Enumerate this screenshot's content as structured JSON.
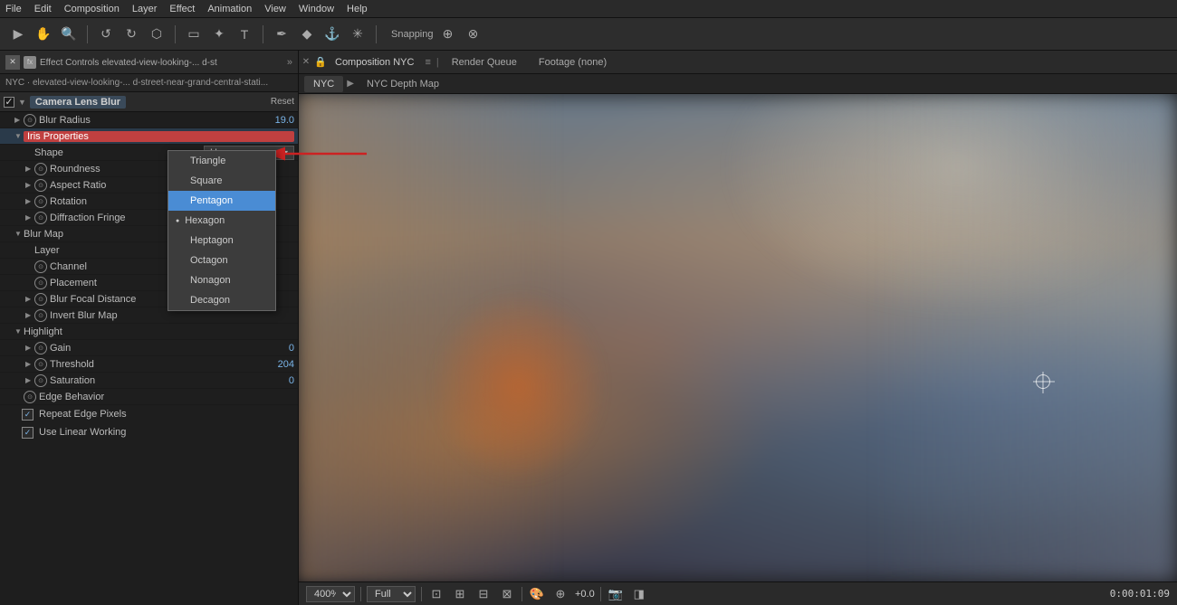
{
  "menubar": {
    "items": [
      "File",
      "Edit",
      "Composition",
      "Layer",
      "Effect",
      "Animation",
      "View",
      "Window",
      "Help"
    ]
  },
  "toolbar": {
    "snapping_label": "Snapping"
  },
  "left_panel": {
    "title": "Effect Controls",
    "title_suffix": "elevated-view-looking-... d-st",
    "breadcrumb": "NYC · elevated-view-looking-... d-street-near-grand-central-stati...",
    "effect": {
      "name": "Camera Lens Blur",
      "reset_label": "Reset",
      "blur_radius_label": "Blur Radius",
      "blur_radius_value": "19.0",
      "iris_properties_label": "Iris Properties",
      "iris_shape_label": "Shape",
      "iris_shape_value": "Hexagon",
      "iris_roundness_label": "Roundness",
      "iris_aspect_ratio_label": "Aspect Ratio",
      "iris_rotation_label": "Rotation",
      "iris_diffraction_label": "Diffraction Fringe",
      "blur_map_label": "Blur Map",
      "blur_map_layer_label": "Layer",
      "blur_map_channel_label": "Channel",
      "blur_map_placement_label": "Placement",
      "blur_focal_distance_label": "Blur Focal Distance",
      "invert_blur_map_label": "Invert Blur Map",
      "highlight_label": "Highlight",
      "gain_label": "Gain",
      "gain_value": "0",
      "threshold_label": "Threshold",
      "threshold_value": "204",
      "saturation_label": "Saturation",
      "saturation_value": "0",
      "edge_behavior_label": "Edge Behavior",
      "repeat_edge_pixels_label": "Repeat Edge Pixels",
      "use_linear_working_label": "Use Linear Working"
    }
  },
  "dropdown": {
    "items": [
      {
        "label": "Triangle",
        "selected": false,
        "current": false
      },
      {
        "label": "Square",
        "selected": false,
        "current": false
      },
      {
        "label": "Pentagon",
        "selected": true,
        "current": false
      },
      {
        "label": "Hexagon",
        "selected": false,
        "current": true
      },
      {
        "label": "Heptagon",
        "selected": false,
        "current": false
      },
      {
        "label": "Octagon",
        "selected": false,
        "current": false
      },
      {
        "label": "Nonagon",
        "selected": false,
        "current": false
      },
      {
        "label": "Decagon",
        "selected": false,
        "current": false
      }
    ]
  },
  "right_panel": {
    "tabs": [
      {
        "label": "Composition",
        "id": "composition"
      },
      {
        "label": "Render Queue"
      },
      {
        "label": "Footage (none)"
      }
    ],
    "comp_name": "NYC",
    "subtabs": [
      "NYC",
      "NYC Depth Map"
    ],
    "active_subtab": "NYC"
  },
  "bottom_toolbar": {
    "zoom_value": "400%",
    "quality_value": "Full",
    "timecode": "0:00:01:09"
  },
  "icons": {
    "close": "✕",
    "triangle_right": "▶",
    "triangle_down": "▼",
    "chevron_down": "▾",
    "lock": "🔒",
    "menu": "≡",
    "check": "✓"
  }
}
